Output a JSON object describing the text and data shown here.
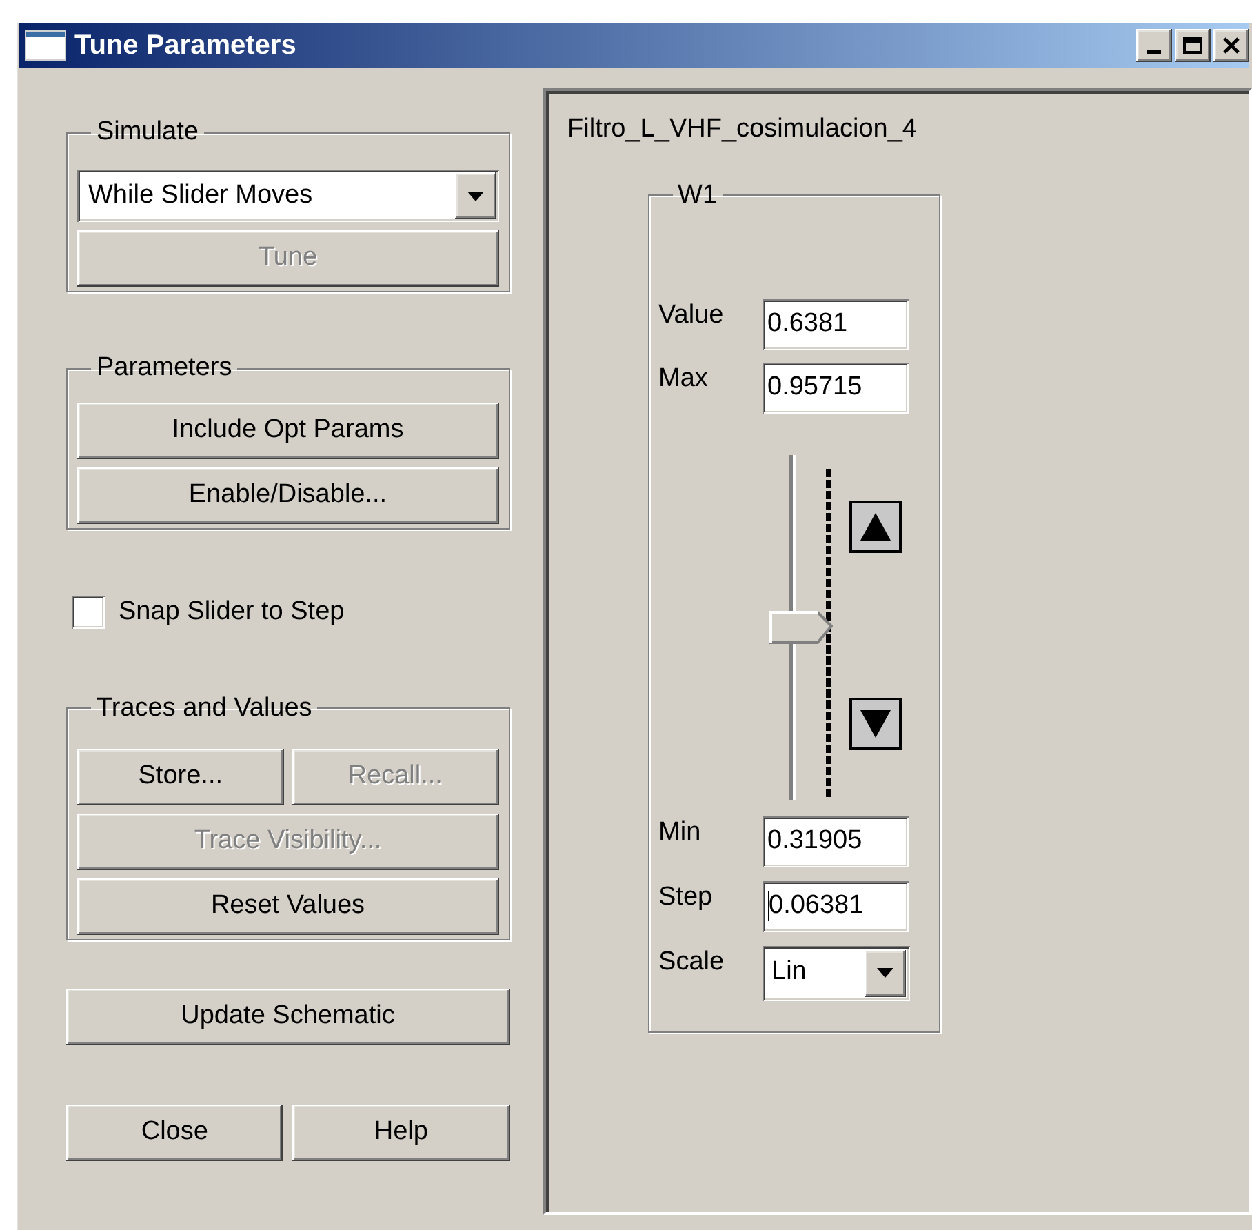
{
  "window": {
    "title": "Tune Parameters"
  },
  "simulate": {
    "label": "Simulate",
    "mode": "While Slider Moves",
    "tune": {
      "label": "Tune",
      "disabled": true
    }
  },
  "parameters": {
    "label": "Parameters",
    "buttons": [
      {
        "label": "Include Opt Params",
        "disabled": false
      },
      {
        "label": "Enable/Disable...",
        "disabled": false
      }
    ]
  },
  "snap": {
    "label": "Snap Slider to Step",
    "checked": false
  },
  "traces": {
    "label": "Traces and Values",
    "rows": [
      [
        {
          "label": "Store...",
          "disabled": false
        },
        {
          "label": "Recall...",
          "disabled": true
        }
      ],
      [
        {
          "label": "Trace Visibility...",
          "disabled": true
        }
      ],
      [
        {
          "label": "Reset Values",
          "disabled": false
        }
      ]
    ]
  },
  "update": {
    "label": "Update Schematic"
  },
  "footer": [
    {
      "label": "Close"
    },
    {
      "label": "Help"
    }
  ],
  "design": {
    "title": "Filtro_L_VHF_cosimulacion_4",
    "parameter": {
      "name": "W1",
      "value_label": "Value",
      "value": "0.6381",
      "max_label": "Max",
      "max": "0.95715",
      "level": 0.5,
      "min_label": "Min",
      "min": "0.31905",
      "step_label": "Step",
      "step": "0.06381",
      "scale_label": "Scale",
      "scale": "Lin"
    }
  }
}
